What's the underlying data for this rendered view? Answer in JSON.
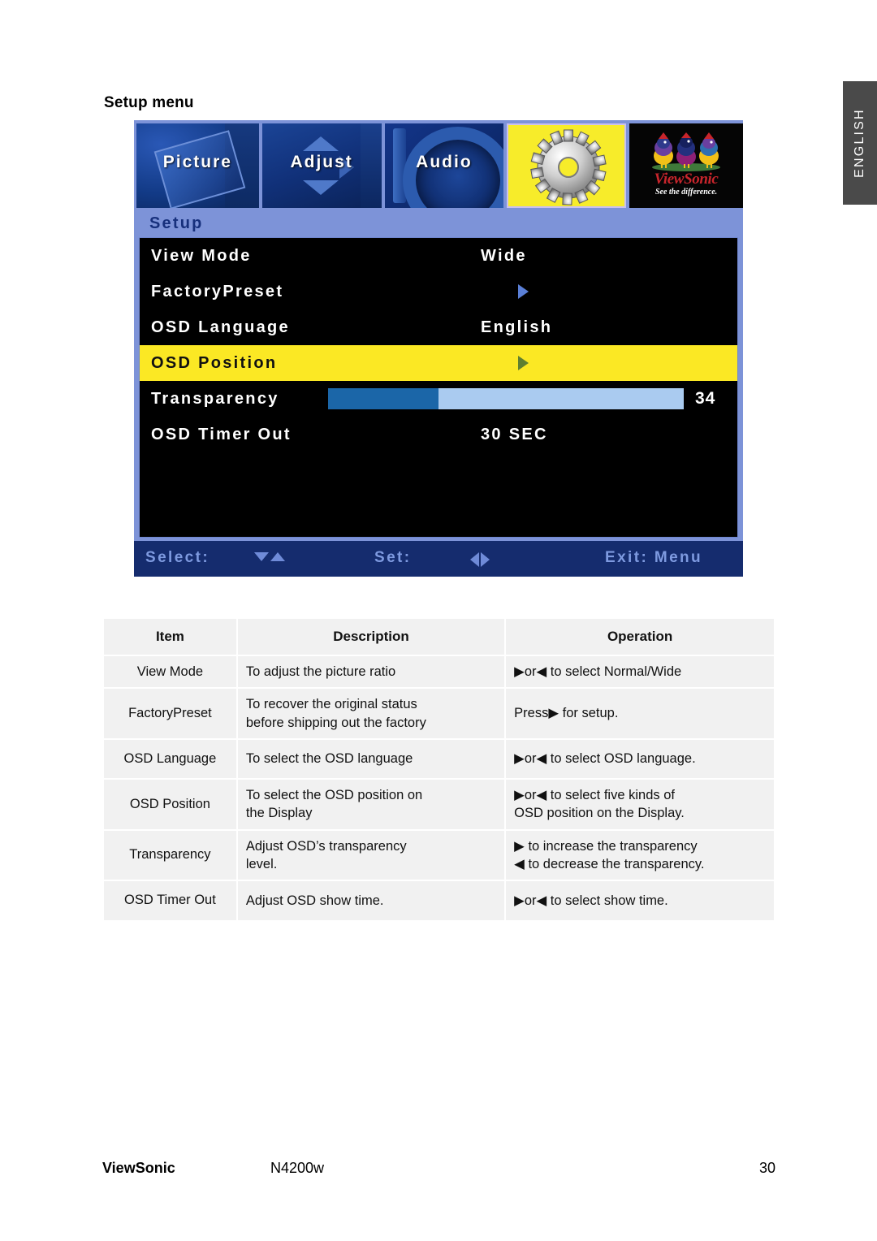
{
  "page": {
    "section_title": "Setup menu",
    "language_tab": "ENGLISH"
  },
  "osd": {
    "tabs": [
      {
        "label": "Picture",
        "icon": "picture-icon",
        "selected": false
      },
      {
        "label": "Adjust",
        "icon": "adjust-arrows-icon",
        "selected": false
      },
      {
        "label": "Audio",
        "icon": "audio-speaker-icon",
        "selected": false
      },
      {
        "label": "",
        "icon": "gear-icon",
        "selected": true
      },
      {
        "label": "",
        "icon": "viewsonic-logo-icon",
        "selected": false
      }
    ],
    "logo": {
      "wordmark": "ViewSonic",
      "tagline": "See the difference."
    },
    "subheader": "Setup",
    "rows": [
      {
        "label": "View Mode",
        "value": "Wide",
        "type": "value",
        "highlight": false
      },
      {
        "label": "FactoryPreset",
        "value": "",
        "type": "submenu",
        "highlight": false
      },
      {
        "label": "OSD Language",
        "value": "English",
        "type": "value",
        "highlight": false
      },
      {
        "label": "OSD Position",
        "value": "",
        "type": "submenu",
        "highlight": true
      },
      {
        "label": "Transparency",
        "value": "34",
        "type": "slider",
        "slider_percent": 31,
        "highlight": false
      },
      {
        "label": "OSD Timer Out",
        "value": "30 SEC",
        "type": "value",
        "highlight": false
      }
    ],
    "footer": {
      "select_label": "Select:",
      "set_label": "Set:",
      "exit_label": "Exit: Menu"
    },
    "colors": {
      "panel_blue": "#7d93d8",
      "highlight_yellow": "#fbe824",
      "slider_fill": "#1b66a8",
      "slider_track": "#aacbf0",
      "footer_bar": "#152c6e"
    }
  },
  "table": {
    "headers": [
      "Item",
      "Description",
      "Operation"
    ],
    "rows": [
      {
        "item": "View Mode",
        "description": [
          "To adjust the picture ratio"
        ],
        "operation": [
          "▶or◀ to select Normal/Wide"
        ]
      },
      {
        "item": "FactoryPreset",
        "description": [
          "To recover the original status",
          "before shipping out the factory"
        ],
        "operation": [
          "Press▶ for setup."
        ]
      },
      {
        "item": "OSD Language",
        "description": [
          "To select the OSD language"
        ],
        "operation": [
          "▶or◀ to select OSD language."
        ]
      },
      {
        "item": "OSD Position",
        "description": [
          "To select the OSD position on",
          "the Display"
        ],
        "operation": [
          "▶or◀ to select five kinds of",
          "OSD position on the Display."
        ]
      },
      {
        "item": "Transparency",
        "description": [
          "Adjust OSD’s transparency",
          "level."
        ],
        "operation": [
          "▶ to increase the transparency",
          "◀ to decrease the transparency."
        ]
      },
      {
        "item": "OSD Timer Out",
        "description": [
          "Adjust OSD show time."
        ],
        "operation": [
          "▶or◀ to select show time."
        ]
      }
    ]
  },
  "footer": {
    "brand": "ViewSonic",
    "model": "N4200w",
    "page_number": "30"
  }
}
